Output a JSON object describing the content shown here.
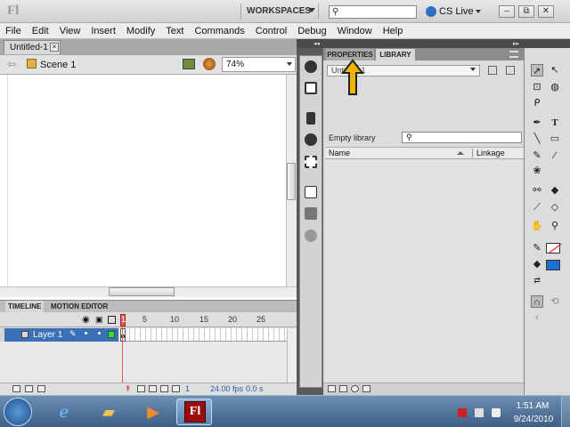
{
  "app": {
    "logo": "Fl",
    "workspace_label": "WORKSPACES",
    "cs_live_label": "CS Live",
    "search_glyph": "⚲"
  },
  "window_controls": {
    "minimize": "–",
    "restore": "⧉",
    "close": "✕"
  },
  "menu": [
    "File",
    "Edit",
    "View",
    "Insert",
    "Modify",
    "Text",
    "Commands",
    "Control",
    "Debug",
    "Window",
    "Help"
  ],
  "document": {
    "tab_title": "Untitled-1",
    "close_glyph": "×",
    "scene": "Scene 1",
    "zoom": "74%"
  },
  "timeline": {
    "tabs": [
      "TIMELINE",
      "MOTION EDITOR"
    ],
    "ruler": [
      "1",
      "5",
      "10",
      "15",
      "20",
      "25"
    ],
    "layer_name": "Layer 1",
    "fps": "24.00 fps",
    "seconds": "0.0 s",
    "current_frame": "1"
  },
  "panel": {
    "tabs": [
      "PROPERTIES",
      "LIBRARY"
    ],
    "active_tab": "LIBRARY",
    "document_select": "Untitled-1",
    "empty_label": "Empty library",
    "columns": [
      "Name",
      "Linkage"
    ]
  },
  "collapse_glyph": "◂◂",
  "expand_glyph": "▸▸",
  "tools": [
    "selection-tool",
    "subselection-tool",
    "free-transform-tool",
    "3d-rotation-tool",
    "lasso-tool",
    "pen-tool",
    "text-tool",
    "line-tool",
    "rectangle-tool",
    "pencil-tool",
    "brush-tool",
    "deco-tool",
    "bone-tool",
    "paint-bucket-tool",
    "eyedropper-tool",
    "eraser-tool",
    "hand-tool",
    "zoom-tool"
  ],
  "colors": {
    "stroke": "#ff0000",
    "fill": "#1f6fd1",
    "accent": "#3b6fb6",
    "flash_red": "#9b0c0c",
    "annotation": "#f0b400"
  },
  "taskbar": {
    "apps": [
      "windows-start",
      "internet-explorer",
      "windows-explorer",
      "media-player",
      "flash-professional"
    ],
    "flash_label": "Fl",
    "time": "1:51 AM",
    "date": "9/24/2010"
  }
}
